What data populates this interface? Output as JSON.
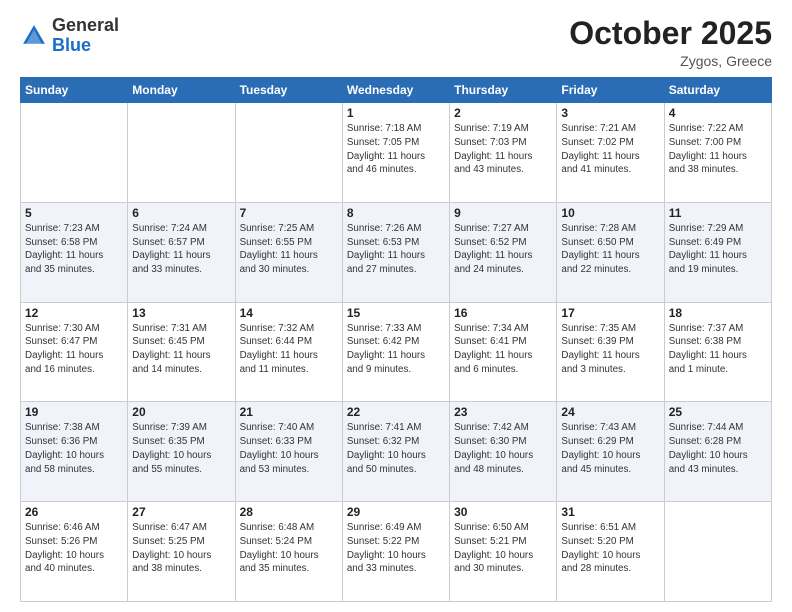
{
  "logo": {
    "general": "General",
    "blue": "Blue"
  },
  "header": {
    "month": "October 2025",
    "location": "Zygos, Greece"
  },
  "weekdays": [
    "Sunday",
    "Monday",
    "Tuesday",
    "Wednesday",
    "Thursday",
    "Friday",
    "Saturday"
  ],
  "weeks": [
    [
      {
        "day": "",
        "info": ""
      },
      {
        "day": "",
        "info": ""
      },
      {
        "day": "",
        "info": ""
      },
      {
        "day": "1",
        "info": "Sunrise: 7:18 AM\nSunset: 7:05 PM\nDaylight: 11 hours\nand 46 minutes."
      },
      {
        "day": "2",
        "info": "Sunrise: 7:19 AM\nSunset: 7:03 PM\nDaylight: 11 hours\nand 43 minutes."
      },
      {
        "day": "3",
        "info": "Sunrise: 7:21 AM\nSunset: 7:02 PM\nDaylight: 11 hours\nand 41 minutes."
      },
      {
        "day": "4",
        "info": "Sunrise: 7:22 AM\nSunset: 7:00 PM\nDaylight: 11 hours\nand 38 minutes."
      }
    ],
    [
      {
        "day": "5",
        "info": "Sunrise: 7:23 AM\nSunset: 6:58 PM\nDaylight: 11 hours\nand 35 minutes."
      },
      {
        "day": "6",
        "info": "Sunrise: 7:24 AM\nSunset: 6:57 PM\nDaylight: 11 hours\nand 33 minutes."
      },
      {
        "day": "7",
        "info": "Sunrise: 7:25 AM\nSunset: 6:55 PM\nDaylight: 11 hours\nand 30 minutes."
      },
      {
        "day": "8",
        "info": "Sunrise: 7:26 AM\nSunset: 6:53 PM\nDaylight: 11 hours\nand 27 minutes."
      },
      {
        "day": "9",
        "info": "Sunrise: 7:27 AM\nSunset: 6:52 PM\nDaylight: 11 hours\nand 24 minutes."
      },
      {
        "day": "10",
        "info": "Sunrise: 7:28 AM\nSunset: 6:50 PM\nDaylight: 11 hours\nand 22 minutes."
      },
      {
        "day": "11",
        "info": "Sunrise: 7:29 AM\nSunset: 6:49 PM\nDaylight: 11 hours\nand 19 minutes."
      }
    ],
    [
      {
        "day": "12",
        "info": "Sunrise: 7:30 AM\nSunset: 6:47 PM\nDaylight: 11 hours\nand 16 minutes."
      },
      {
        "day": "13",
        "info": "Sunrise: 7:31 AM\nSunset: 6:45 PM\nDaylight: 11 hours\nand 14 minutes."
      },
      {
        "day": "14",
        "info": "Sunrise: 7:32 AM\nSunset: 6:44 PM\nDaylight: 11 hours\nand 11 minutes."
      },
      {
        "day": "15",
        "info": "Sunrise: 7:33 AM\nSunset: 6:42 PM\nDaylight: 11 hours\nand 9 minutes."
      },
      {
        "day": "16",
        "info": "Sunrise: 7:34 AM\nSunset: 6:41 PM\nDaylight: 11 hours\nand 6 minutes."
      },
      {
        "day": "17",
        "info": "Sunrise: 7:35 AM\nSunset: 6:39 PM\nDaylight: 11 hours\nand 3 minutes."
      },
      {
        "day": "18",
        "info": "Sunrise: 7:37 AM\nSunset: 6:38 PM\nDaylight: 11 hours\nand 1 minute."
      }
    ],
    [
      {
        "day": "19",
        "info": "Sunrise: 7:38 AM\nSunset: 6:36 PM\nDaylight: 10 hours\nand 58 minutes."
      },
      {
        "day": "20",
        "info": "Sunrise: 7:39 AM\nSunset: 6:35 PM\nDaylight: 10 hours\nand 55 minutes."
      },
      {
        "day": "21",
        "info": "Sunrise: 7:40 AM\nSunset: 6:33 PM\nDaylight: 10 hours\nand 53 minutes."
      },
      {
        "day": "22",
        "info": "Sunrise: 7:41 AM\nSunset: 6:32 PM\nDaylight: 10 hours\nand 50 minutes."
      },
      {
        "day": "23",
        "info": "Sunrise: 7:42 AM\nSunset: 6:30 PM\nDaylight: 10 hours\nand 48 minutes."
      },
      {
        "day": "24",
        "info": "Sunrise: 7:43 AM\nSunset: 6:29 PM\nDaylight: 10 hours\nand 45 minutes."
      },
      {
        "day": "25",
        "info": "Sunrise: 7:44 AM\nSunset: 6:28 PM\nDaylight: 10 hours\nand 43 minutes."
      }
    ],
    [
      {
        "day": "26",
        "info": "Sunrise: 6:46 AM\nSunset: 5:26 PM\nDaylight: 10 hours\nand 40 minutes."
      },
      {
        "day": "27",
        "info": "Sunrise: 6:47 AM\nSunset: 5:25 PM\nDaylight: 10 hours\nand 38 minutes."
      },
      {
        "day": "28",
        "info": "Sunrise: 6:48 AM\nSunset: 5:24 PM\nDaylight: 10 hours\nand 35 minutes."
      },
      {
        "day": "29",
        "info": "Sunrise: 6:49 AM\nSunset: 5:22 PM\nDaylight: 10 hours\nand 33 minutes."
      },
      {
        "day": "30",
        "info": "Sunrise: 6:50 AM\nSunset: 5:21 PM\nDaylight: 10 hours\nand 30 minutes."
      },
      {
        "day": "31",
        "info": "Sunrise: 6:51 AM\nSunset: 5:20 PM\nDaylight: 10 hours\nand 28 minutes."
      },
      {
        "day": "",
        "info": ""
      }
    ]
  ]
}
